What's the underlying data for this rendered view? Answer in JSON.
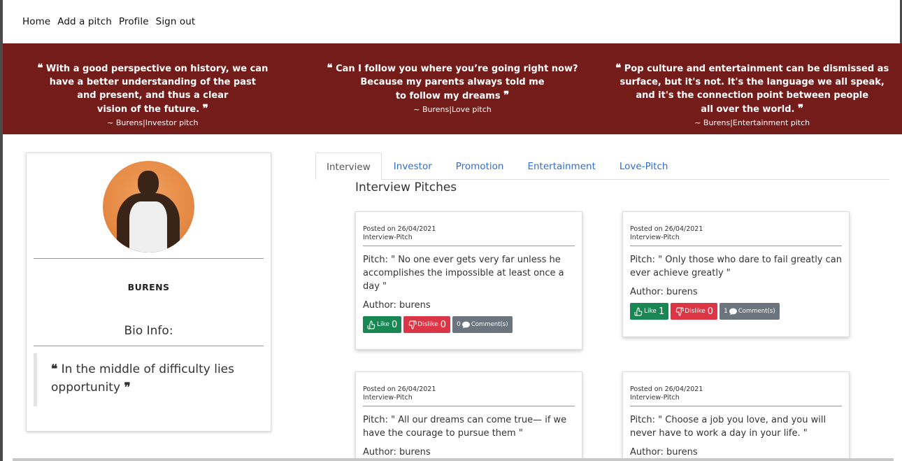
{
  "nav": {
    "items": [
      "Home",
      "Add a pitch",
      "Profile",
      "Sign out"
    ]
  },
  "banner": {
    "color": "#731c1a",
    "quotes": [
      {
        "lines": [
          "With a good perspective on history, we can",
          "have a better understanding of the past",
          "and present, and thus a clear",
          "vision of the future."
        ],
        "source": "~ Burens|Investor pitch"
      },
      {
        "lines": [
          "Can I follow you where you’re going right now?",
          "Because my parents always told me",
          "to follow my dreams"
        ],
        "source": "~ Burens|Love pitch"
      },
      {
        "lines": [
          "Pop culture and entertainment can be dismissed as",
          "surface, but it's not. It's the language we all speak,",
          "and it's the connection point between people",
          "all over the world."
        ],
        "source": "~ Burens|Entertainment pitch"
      }
    ]
  },
  "profile": {
    "username": "BURENS",
    "bio_title": "Bio Info:",
    "bio": "In the middle of difficulty lies opportunity"
  },
  "tabs": [
    "Interview",
    "Investor",
    "Promotion",
    "Entertainment",
    "Love-Pitch"
  ],
  "section_title": "Interview Pitches",
  "pitches": [
    {
      "posted": "Posted on 26/04/2021",
      "category": "Interview-Pitch",
      "text": "Pitch: \" No one ever gets very far unless he accomplishes the impossible at least once a day \"",
      "author": "Author: burens",
      "like_label": "Like",
      "likes": "0",
      "dislike_label": "Dislike",
      "dislikes": "0",
      "comments": "0",
      "comment_label": "Comment(s)"
    },
    {
      "posted": "Posted on 26/04/2021",
      "category": "Interview-Pitch",
      "text": "Pitch: \" Only those who dare to fail greatly can ever achieve greatly \"",
      "author": "Author: burens",
      "like_label": "Like",
      "likes": "1",
      "dislike_label": "Dislike",
      "dislikes": "0",
      "comments": "1",
      "comment_label": "Comment(s)"
    },
    {
      "posted": "Posted on 26/04/2021",
      "category": "Interview-Pitch",
      "text": "Pitch: \" All our dreams can come true— if we have the courage to pursue them \"",
      "author": "Author: burens"
    },
    {
      "posted": "Posted on 26/04/2021",
      "category": "Interview-Pitch",
      "text": "Pitch: \" Choose a job you love, and you will never have to work a day in your life. \"",
      "author": "Author: burens"
    }
  ]
}
